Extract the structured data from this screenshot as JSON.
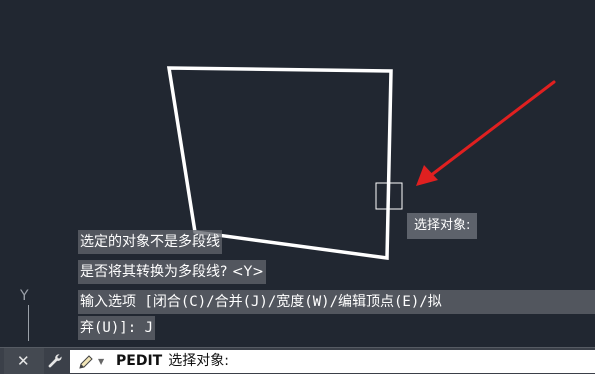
{
  "tooltip": {
    "text": "选择对象:"
  },
  "history": {
    "line1": "选定的对象不是多段线",
    "line2": "是否将其转换为多段线? <Y>",
    "line3": "输入选项 [闭合(C)/合并(J)/宽度(W)/编辑顶点(E)/拟",
    "line4": "弃(U)]: J"
  },
  "ucs": {
    "y_label": "Y"
  },
  "command_line": {
    "close_glyph": "✕",
    "command_name": "PEDIT",
    "prompt": "选择对象:"
  },
  "colors": {
    "background": "#212731",
    "geometry": "#ffffff",
    "arrow": "#e02020",
    "history_bg": "#60646c"
  }
}
